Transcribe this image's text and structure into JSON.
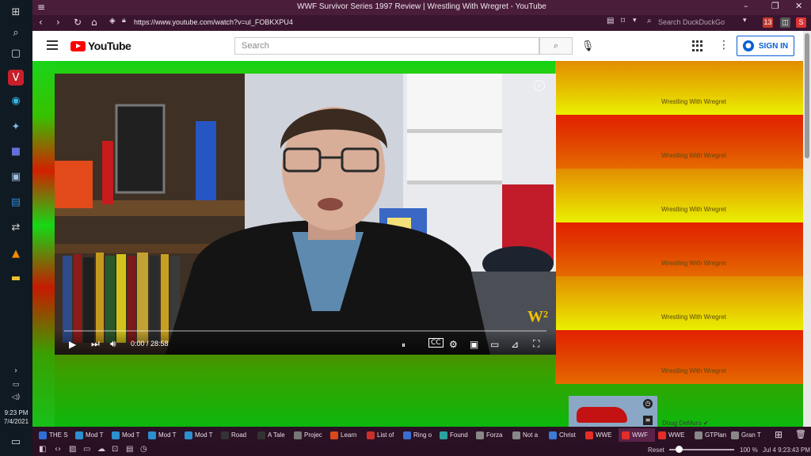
{
  "window": {
    "title": "WWF Survivor Series 1997 Review | Wrestling With Wregret - YouTube"
  },
  "addressbar": {
    "url": "https://www.youtube.com/watch?v=ul_FOBKXPU4",
    "search_placeholder": "Search DuckDuckGo",
    "badge_count": "13"
  },
  "youtube": {
    "logo_text": "YouTube",
    "search_placeholder": "Search",
    "signin_label": "SIGN IN"
  },
  "player": {
    "time": "0:00 / 28:58",
    "progress_fraction": 0,
    "watermark": "W²"
  },
  "sidebar_rows": [
    {
      "label": "Wrestling With Wregret",
      "style": "yellow"
    },
    {
      "label": "Wrestling With Wregret",
      "style": "red"
    },
    {
      "label": "Wrestling With Wregret",
      "style": "yellow"
    },
    {
      "label": "Wrestling With Wregret",
      "style": "red"
    },
    {
      "label": "Wrestling With Wregret",
      "style": "yellow"
    },
    {
      "label": "Wrestling With Wregret",
      "style": "red"
    }
  ],
  "thumbnail_channel": "Doug DeMuro ✔",
  "taskbar": {
    "time": "9:23 PM",
    "date": "7/4/2021"
  },
  "tabs": [
    {
      "label": "THE S",
      "color": "#2f6fd6"
    },
    {
      "label": "Mod T",
      "color": "#2b8fd0"
    },
    {
      "label": "Mod T",
      "color": "#2b8fd0"
    },
    {
      "label": "Mod T",
      "color": "#2b8fd0"
    },
    {
      "label": "Mod T",
      "color": "#2b8fd0"
    },
    {
      "label": "Road",
      "color": "#333333"
    },
    {
      "label": "A Tale",
      "color": "#333333"
    },
    {
      "label": "Projec",
      "color": "#777777"
    },
    {
      "label": "Learn",
      "color": "#d94a1a"
    },
    {
      "label": "List of",
      "color": "#c8302a"
    },
    {
      "label": "Ring o",
      "color": "#3b6ed0"
    },
    {
      "label": "Found",
      "color": "#2aa3a0"
    },
    {
      "label": "Forza",
      "color": "#888888"
    },
    {
      "label": "Not a",
      "color": "#888888"
    },
    {
      "label": "Christ",
      "color": "#3a7bd5"
    },
    {
      "label": "WWE",
      "color": "#e52d27"
    },
    {
      "label": "WWF",
      "color": "#e52d27",
      "active": true
    },
    {
      "label": "WWE",
      "color": "#e52d27"
    },
    {
      "label": "GTPlan",
      "color": "#888888"
    },
    {
      "label": "Gran T",
      "color": "#888888"
    }
  ],
  "statusbar": {
    "reset_label": "Reset",
    "zoom": "100 %",
    "clock": "Jul 4  9:23:43 PM"
  }
}
